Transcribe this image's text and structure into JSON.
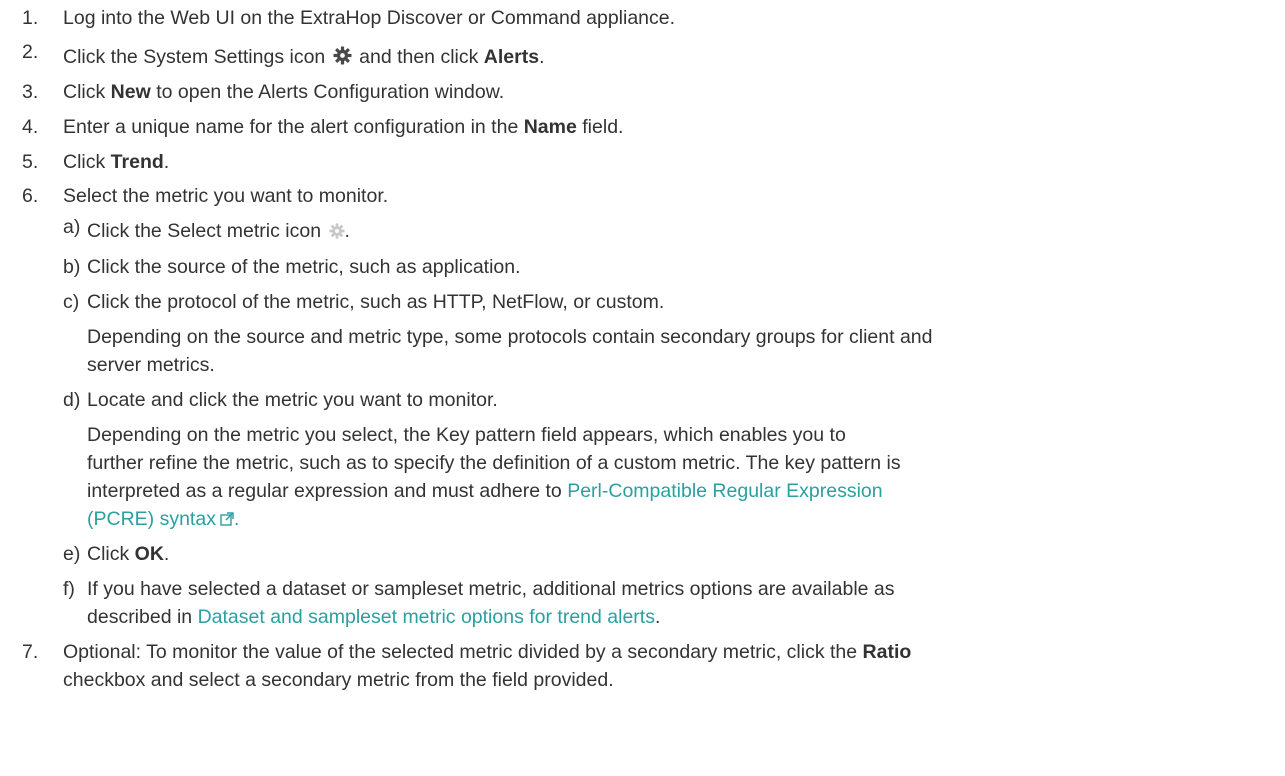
{
  "steps": [
    {
      "num": "1.",
      "text": "Log into the Web UI on the ExtraHop Discover or Command appliance."
    },
    {
      "num": "2.",
      "pre": "Click the System Settings icon",
      "mid": "and then click",
      "bold": "Alerts",
      "post": "."
    },
    {
      "num": "3.",
      "pre": "Click",
      "bold": "New",
      "post": "to open the Alerts Configuration window."
    },
    {
      "num": "4.",
      "pre": "Enter a unique name for the alert configuration in the",
      "bold": "Name",
      "post": "field."
    },
    {
      "num": "5.",
      "pre": "Click",
      "bold": "Trend",
      "post": "."
    },
    {
      "num": "6.",
      "text": "Select the metric you want to monitor."
    },
    {
      "num": "7.",
      "pre": "Optional: To monitor the value of the selected metric divided by a secondary metric, click the",
      "bold": "Ratio",
      "line2": "checkbox and select a secondary metric from the field provided."
    }
  ],
  "substeps": [
    {
      "letter": "a)",
      "text": "Click the Select metric icon",
      "post": "."
    },
    {
      "letter": "b)",
      "text": "Click the source of the metric, such as application."
    },
    {
      "letter": "c)",
      "text": "Click the protocol of the metric, such as HTTP, NetFlow, or custom.",
      "note1": "Depending on the source and metric type, some protocols contain secondary groups for client and",
      "note2": "server metrics."
    },
    {
      "letter": "d)",
      "text": "Locate and click the metric you want to monitor.",
      "note1": "Depending on the metric you select, the Key pattern field appears, which enables you to",
      "note2": "further refine the metric, such as to specify the definition of a custom metric. The key pattern is",
      "note3": "interpreted as a regular expression and must adhere to",
      "link1": "Perl-Compatible Regular Expression",
      "link2": "(PCRE) syntax",
      "link_post": "."
    },
    {
      "letter": "e)",
      "pre": "Click",
      "bold": "OK",
      "post": "."
    },
    {
      "letter": "f)",
      "text": "If you have selected a dataset or sampleset metric, additional metrics options are available as",
      "line2_pre": "described in",
      "line2_link": "Dataset and sampleset metric options for trend alerts",
      "line2_post": "."
    }
  ],
  "icons": {
    "system_settings": "gear-icon",
    "select_metric": "gear-light-icon",
    "external_link": "external-link-icon"
  },
  "colors": {
    "text": "#333333",
    "link": "#2aa0a0"
  }
}
